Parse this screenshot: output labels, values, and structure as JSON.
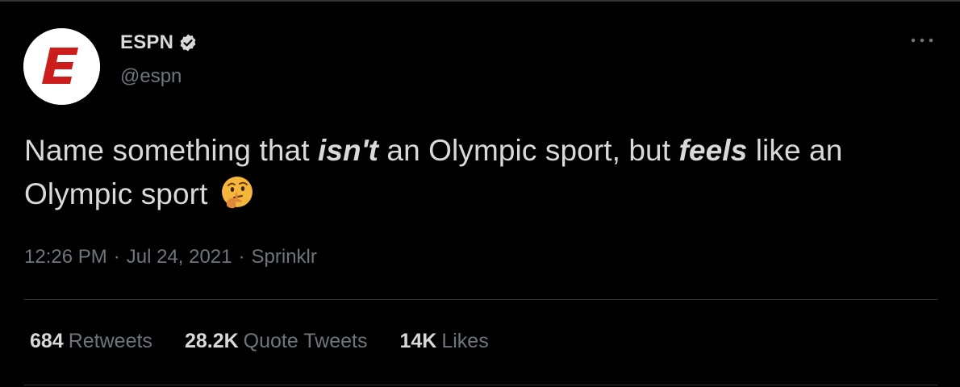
{
  "account": {
    "display_name": "ESPN",
    "handle": "@espn",
    "verified": true,
    "avatar_icon": "espn-logo-icon",
    "brand_color": "#cc1d1d"
  },
  "menu": {
    "icon": "more-icon"
  },
  "tweet": {
    "text_parts": {
      "p1": "Name something that ",
      "p2": "isn't",
      "p3": " an Olympic sport, but ",
      "p4": "feels",
      "p5": " like an Olympic sport"
    },
    "emoji": "thinking-face-icon"
  },
  "meta": {
    "time": "12:26 PM",
    "separator": "·",
    "date": "Jul 24, 2021",
    "source": "Sprinklr"
  },
  "stats": {
    "retweets": {
      "count": "684",
      "label": "Retweets"
    },
    "quotes": {
      "count": "28.2K",
      "label": "Quote Tweets"
    },
    "likes": {
      "count": "14K",
      "label": "Likes"
    }
  },
  "colors": {
    "background": "#000000",
    "text": "#d9d9d9",
    "secondary_text": "#6e767d",
    "divider": "#2f3336",
    "verified_badge": "#d9d9d9"
  }
}
